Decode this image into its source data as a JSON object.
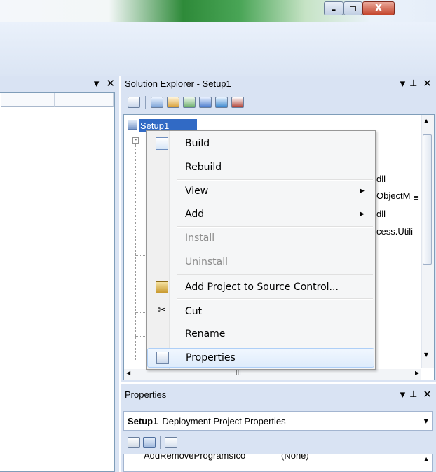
{
  "window": {
    "minimize_glyph": "–",
    "maximize_glyph": "▫",
    "close_glyph": "X"
  },
  "left_panel": {
    "dropdown_glyph": "▾",
    "close_glyph": "✕"
  },
  "solution_explorer": {
    "title": "Solution Explorer - Setup1",
    "dropdown_glyph": "▾",
    "pin_glyph": "⊥",
    "close_glyph": "✕",
    "selected_node": "Setup1",
    "partial_items": [
      "dll",
      "ObjectM",
      "dll",
      "cess.Utili"
    ]
  },
  "context_menu": {
    "items": [
      {
        "label": "Build",
        "icon": "build-icon"
      },
      {
        "label": "Rebuild"
      },
      {
        "label": "View",
        "submenu": true
      },
      {
        "label": "Add",
        "submenu": true
      },
      {
        "label": "Install",
        "disabled": true
      },
      {
        "label": "Uninstall",
        "disabled": true
      },
      {
        "label": "Add Project to Source Control...",
        "icon": "source-control-icon"
      },
      {
        "label": "Cut",
        "icon": "cut-icon"
      },
      {
        "label": "Rename"
      },
      {
        "label": "Properties",
        "icon": "properties-icon",
        "highlighted": true
      }
    ],
    "submenu_arrow": "▶"
  },
  "properties_panel": {
    "title": "Properties",
    "dropdown_glyph": "▾",
    "pin_glyph": "⊥",
    "close_glyph": "✕",
    "object_name": "Setup1",
    "object_type": "Deployment Project Properties",
    "combo_arrow": "▾",
    "first_row": "AddRemoveProgramsIco",
    "first_row_value": "(None)"
  },
  "colors": {
    "selection": "#316ac5",
    "highlight_border": "#aecff7",
    "disabled_text": "#8d8d8d"
  }
}
